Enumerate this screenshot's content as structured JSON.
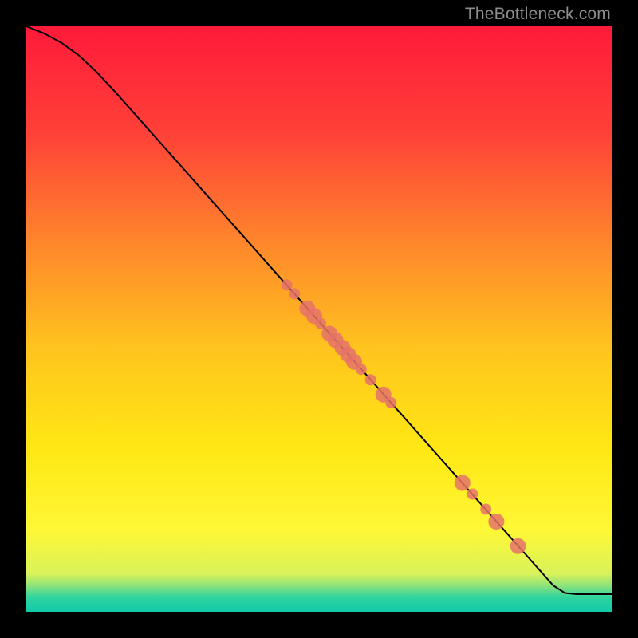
{
  "watermark": "TheBottleneck.com",
  "chart_data": {
    "type": "line",
    "title": "",
    "xlabel": "",
    "ylabel": "",
    "xlim": [
      0,
      100
    ],
    "ylim": [
      0,
      100
    ],
    "background_gradient": {
      "stops": [
        {
          "offset": 0.0,
          "color": "#ff1a3a"
        },
        {
          "offset": 0.18,
          "color": "#ff4038"
        },
        {
          "offset": 0.38,
          "color": "#ff8a2b"
        },
        {
          "offset": 0.55,
          "color": "#ffc41e"
        },
        {
          "offset": 0.72,
          "color": "#ffe714"
        },
        {
          "offset": 0.86,
          "color": "#fff835"
        },
        {
          "offset": 0.935,
          "color": "#d9f25a"
        },
        {
          "offset": 0.955,
          "color": "#8fe37a"
        },
        {
          "offset": 0.975,
          "color": "#30d49e"
        },
        {
          "offset": 1.0,
          "color": "#11caa9"
        }
      ]
    },
    "series": [
      {
        "name": "curve",
        "type": "line",
        "color": "#000000",
        "points": [
          {
            "x": 0.0,
            "y": 100.0
          },
          {
            "x": 3.0,
            "y": 98.8
          },
          {
            "x": 6.0,
            "y": 97.2
          },
          {
            "x": 9.0,
            "y": 95.0
          },
          {
            "x": 12.0,
            "y": 92.2
          },
          {
            "x": 15.0,
            "y": 89.0
          },
          {
            "x": 90.0,
            "y": 4.5
          },
          {
            "x": 92.0,
            "y": 3.2
          },
          {
            "x": 94.0,
            "y": 3.0
          },
          {
            "x": 100.0,
            "y": 3.0
          }
        ]
      },
      {
        "name": "markers",
        "type": "scatter",
        "color": "#e57368",
        "radius_small": 7,
        "radius_large": 10,
        "points": [
          {
            "x": 44.5,
            "y": 55.8,
            "r": "small"
          },
          {
            "x": 45.8,
            "y": 54.3,
            "r": "small"
          },
          {
            "x": 48.0,
            "y": 51.8,
            "r": "large"
          },
          {
            "x": 49.2,
            "y": 50.5,
            "r": "large"
          },
          {
            "x": 50.3,
            "y": 49.2,
            "r": "small"
          },
          {
            "x": 51.8,
            "y": 47.5,
            "r": "large"
          },
          {
            "x": 52.8,
            "y": 46.4,
            "r": "large"
          },
          {
            "x": 54.0,
            "y": 45.1,
            "r": "large"
          },
          {
            "x": 55.0,
            "y": 43.9,
            "r": "large"
          },
          {
            "x": 56.0,
            "y": 42.7,
            "r": "large"
          },
          {
            "x": 57.2,
            "y": 41.4,
            "r": "small"
          },
          {
            "x": 58.8,
            "y": 39.6,
            "r": "small"
          },
          {
            "x": 61.0,
            "y": 37.1,
            "r": "large"
          },
          {
            "x": 62.3,
            "y": 35.7,
            "r": "small"
          },
          {
            "x": 74.5,
            "y": 22.0,
            "r": "large"
          },
          {
            "x": 76.2,
            "y": 20.1,
            "r": "small"
          },
          {
            "x": 78.5,
            "y": 17.5,
            "r": "small"
          },
          {
            "x": 80.3,
            "y": 15.4,
            "r": "large"
          },
          {
            "x": 84.0,
            "y": 11.2,
            "r": "large"
          }
        ]
      }
    ]
  }
}
